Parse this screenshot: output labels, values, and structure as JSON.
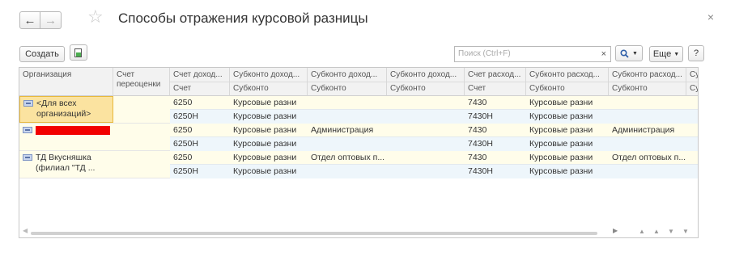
{
  "header": {
    "back_icon": "arrow-left-icon",
    "forward_icon": "arrow-right-icon",
    "favorite_icon": "star-icon",
    "title": "Способы отражения курсовой разницы",
    "close_glyph": "×"
  },
  "toolbar": {
    "create_label": "Создать",
    "search_placeholder": "Поиск (Ctrl+F)",
    "search_clear": "×",
    "more_label": "Еще",
    "help_label": "?"
  },
  "table": {
    "columns": [
      {
        "top": "Организация",
        "bottom": ""
      },
      {
        "top": "Счет",
        "bottom": "переоценки"
      },
      {
        "top": "Счет доход...",
        "bottom": "Счет"
      },
      {
        "top": "Субконто доход...",
        "bottom": "Субконто"
      },
      {
        "top": "Субконто доход...",
        "bottom": "Субконто"
      },
      {
        "top": "Субконто доход...",
        "bottom": "Субконто"
      },
      {
        "top": "Счет расход...",
        "bottom": "Счет"
      },
      {
        "top": "Субконто расход...",
        "bottom": "Субконто"
      },
      {
        "top": "Субконто расход...",
        "bottom": "Субконто"
      },
      {
        "top": "Су",
        "bottom": "Су"
      }
    ],
    "rows": [
      {
        "org_line1": "<Для всех",
        "org_line2": "организаций>",
        "lines": [
          [
            "6250",
            "Курсовые разни",
            "",
            "",
            "7430",
            "Курсовые разни",
            "",
            ""
          ],
          [
            "6250Н",
            "Курсовые разни",
            "",
            "",
            "7430Н",
            "Курсовые разни",
            "",
            ""
          ]
        ]
      },
      {
        "org_line1": "",
        "org_line2": "",
        "lines": [
          [
            "6250",
            "Курсовые разни",
            "Администрация",
            "",
            "7430",
            "Курсовые разни",
            "Администрация",
            ""
          ],
          [
            "6250Н",
            "Курсовые разни",
            "",
            "",
            "7430Н",
            "Курсовые разни",
            "",
            ""
          ]
        ]
      },
      {
        "org_line1": "ТД Вкусняшка",
        "org_line2": "(филиал \"ТД ...",
        "lines": [
          [
            "6250",
            "Курсовые разни",
            "Отдел оптовых п...",
            "",
            "7430",
            "Курсовые разни",
            "Отдел оптовых п...",
            ""
          ],
          [
            "6250Н",
            "Курсовые разни",
            "",
            "",
            "7430Н",
            "Курсовые разни",
            "",
            ""
          ]
        ]
      }
    ]
  },
  "colors": {
    "selected_bg": "#fbe3a0",
    "alt_row_bg": "#fffdea",
    "sub_row_bg": "#eef6fb",
    "redacted": "#f20000"
  }
}
